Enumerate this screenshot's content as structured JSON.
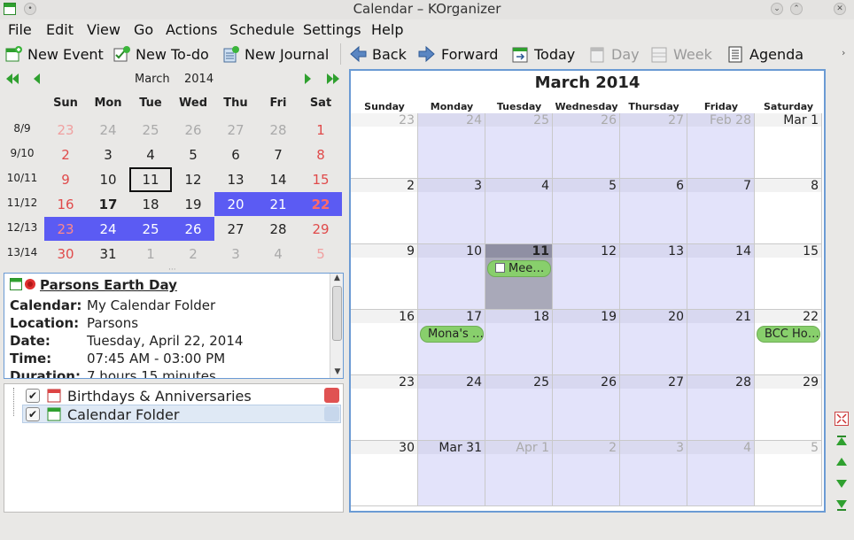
{
  "window": {
    "title": "Calendar – KOrganizer"
  },
  "menu": [
    "File",
    "Edit",
    "View",
    "Go",
    "Actions",
    "Schedule",
    "Settings",
    "Help"
  ],
  "toolbar": {
    "new_event": "New Event",
    "new_todo": "New To-do",
    "new_journal": "New Journal",
    "back": "Back",
    "forward": "Forward",
    "today": "Today",
    "day": "Day",
    "week": "Week",
    "agenda": "Agenda"
  },
  "mini_calendar": {
    "month": "March",
    "year": "2014",
    "weekday_headers": [
      "Sun",
      "Mon",
      "Tue",
      "Wed",
      "Thu",
      "Fri",
      "Sat"
    ],
    "week_labels": [
      "8/9",
      "9/10",
      "10/11",
      "11/12",
      "12/13",
      "13/14"
    ],
    "weeks": [
      [
        "23",
        "24",
        "25",
        "26",
        "27",
        "28",
        "1"
      ],
      [
        "2",
        "3",
        "4",
        "5",
        "6",
        "7",
        "8"
      ],
      [
        "9",
        "10",
        "11",
        "12",
        "13",
        "14",
        "15"
      ],
      [
        "16",
        "17",
        "18",
        "19",
        "20",
        "21",
        "22"
      ],
      [
        "23",
        "24",
        "25",
        "26",
        "27",
        "28",
        "29"
      ],
      [
        "30",
        "31",
        "1",
        "2",
        "3",
        "4",
        "5"
      ]
    ]
  },
  "event_viewer": {
    "title": "Parsons Earth Day",
    "fields": [
      {
        "label": "Calendar:",
        "value": "My Calendar Folder"
      },
      {
        "label": "Location:",
        "value": "Parsons"
      },
      {
        "label": "Date:",
        "value": "Tuesday, April 22, 2014"
      },
      {
        "label": "Time:",
        "value": "07:45 AM - 03:00 PM"
      },
      {
        "label": "Duration:",
        "value": "7 hours 15 minutes"
      }
    ]
  },
  "resources": [
    {
      "name": "Birthdays & Anniversaries",
      "checked": true,
      "color": "#e05252"
    },
    {
      "name": "Calendar Folder",
      "checked": true,
      "color": "#c7d7ec"
    }
  ],
  "month_view": {
    "title": "March 2014",
    "weekday_headers": [
      "Sunday",
      "Monday",
      "Tuesday",
      "Wednesday",
      "Thursday",
      "Friday",
      "Saturday"
    ],
    "weeks": [
      [
        "23",
        "24",
        "25",
        "26",
        "27",
        "Feb 28",
        "Mar 1"
      ],
      [
        "2",
        "3",
        "4",
        "5",
        "6",
        "7",
        "8"
      ],
      [
        "9",
        "10",
        "11",
        "12",
        "13",
        "14",
        "15"
      ],
      [
        "16",
        "17",
        "18",
        "19",
        "20",
        "21",
        "22"
      ],
      [
        "23",
        "24",
        "25",
        "26",
        "27",
        "28",
        "29"
      ],
      [
        "30",
        "Mar 31",
        "Apr 1",
        "2",
        "3",
        "4",
        "5"
      ]
    ],
    "events": [
      {
        "week": 2,
        "day": 2,
        "label": "Mee…"
      },
      {
        "week": 3,
        "day": 1,
        "label": "Mona's …"
      },
      {
        "week": 3,
        "day": 6,
        "label": "BCC Ho…"
      }
    ]
  },
  "colors": {
    "selection": "#5b5bf3",
    "workday": "#e3e3fa",
    "today": "#a9a9b9",
    "holiday_text": "#e04a4a",
    "event_green": "#88cf6c"
  }
}
